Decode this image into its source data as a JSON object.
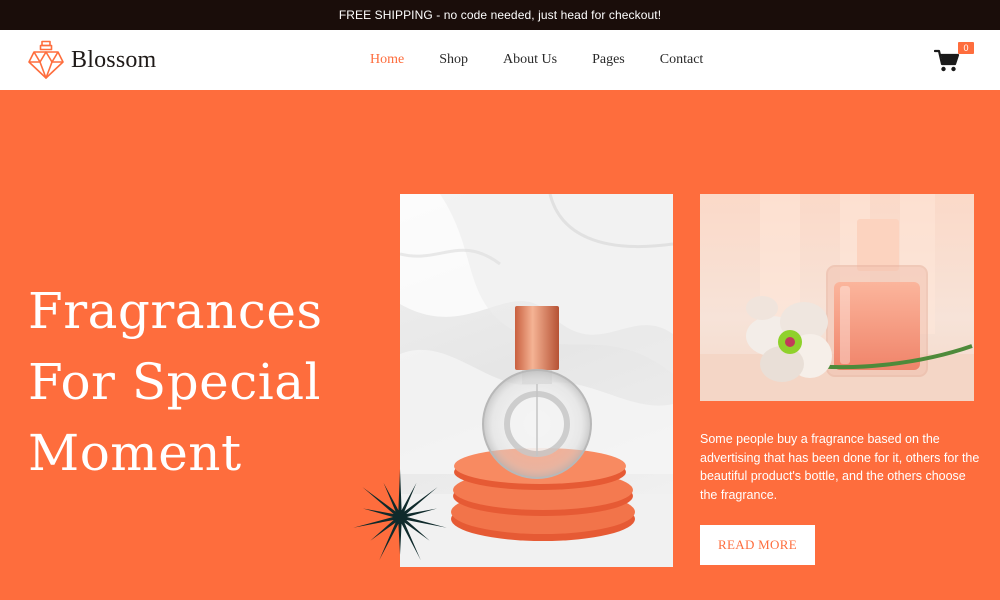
{
  "topbar": {
    "text": "FREE SHIPPING - no code needed, just head for checkout!"
  },
  "brand": {
    "name": "Blossom",
    "logo_icon": "perfume-bottle-icon",
    "accent_color": "#fe6d3d"
  },
  "nav": {
    "items": [
      {
        "label": "Home",
        "active": true
      },
      {
        "label": "Shop",
        "active": false
      },
      {
        "label": "About Us",
        "active": false
      },
      {
        "label": "Pages",
        "active": false
      },
      {
        "label": "Contact",
        "active": false
      }
    ]
  },
  "cart": {
    "icon": "cart-icon",
    "count": "0"
  },
  "hero": {
    "title_lines": [
      "Fragrances",
      "For Special",
      "Moment"
    ],
    "description": "Some people buy a fragrance based on the advertising that has been done for it, others for the beautiful product's bottle, and the others choose the fragrance.",
    "cta_label": "READ MORE",
    "background_color": "#fe6d3d"
  }
}
